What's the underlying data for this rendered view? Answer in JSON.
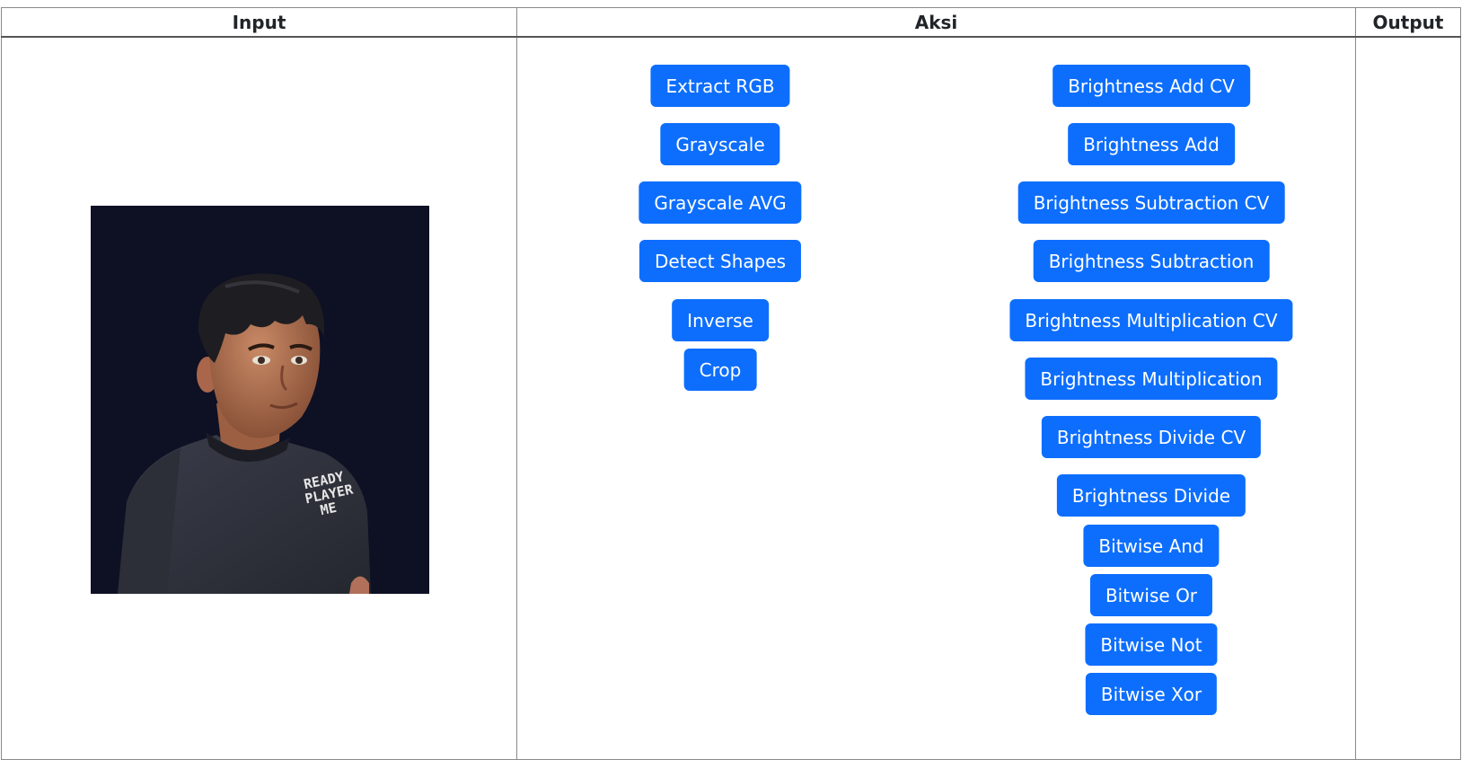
{
  "headers": {
    "input": "Input",
    "aksi": "Aksi",
    "output": "Output"
  },
  "avatar": {
    "shirt_text": [
      "READY",
      "PLAYER",
      "ME"
    ],
    "background_color": "#0e1024"
  },
  "buttons_left": [
    "Extract RGB",
    "Grayscale",
    "Grayscale AVG",
    "Detect Shapes",
    "Inverse",
    "Crop"
  ],
  "buttons_right": [
    "Brightness Add CV",
    "Brightness Add",
    "Brightness Subtraction CV",
    "Brightness Subtraction",
    "Brightness Multiplication CV",
    "Brightness Multiplication",
    "Brightness Divide CV",
    "Brightness Divide",
    "Bitwise And",
    "Bitwise Or",
    "Bitwise Not",
    "Bitwise Xor"
  ],
  "colors": {
    "button_bg": "#0d6efd",
    "button_text": "#ffffff",
    "header_text": "#212529"
  }
}
